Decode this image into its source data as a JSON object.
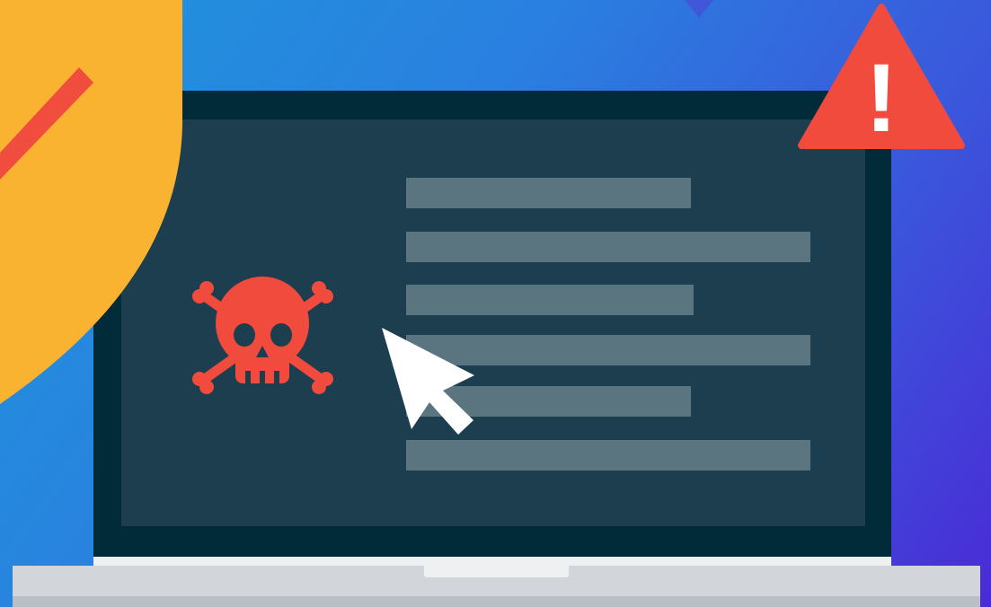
{
  "scene": {
    "background_gradient": [
      "#1f95db",
      "#2a7fe0",
      "#3a58dc",
      "#4a2bd6"
    ],
    "shield": {
      "icon": "shield-icon",
      "fill": "#f9b331",
      "stripe": "#f04d3e"
    },
    "warning": {
      "icon": "warning-triangle-icon",
      "fill": "#f04b3d",
      "symbol": "!"
    },
    "skull": {
      "icon": "skull-crossbones-icon",
      "fill": "#f04b3d"
    },
    "cursor": {
      "icon": "mouse-pointer-icon",
      "fill": "#ffffff"
    },
    "laptop": {
      "bezel_color": "#022b3a",
      "screen_color": "#1c3e4f",
      "text_line_color": "#5b7580",
      "text_line_count": 6,
      "base_color": "#d2d6da"
    }
  }
}
